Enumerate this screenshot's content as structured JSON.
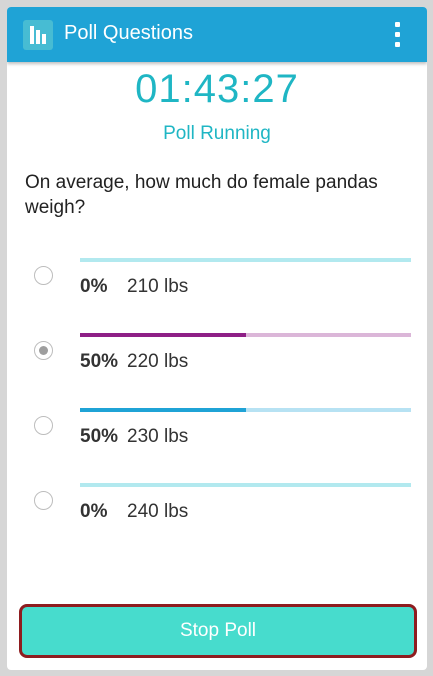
{
  "app_bar": {
    "title": "Poll Questions",
    "app_icon": "bar-chart-icon",
    "menu_icon": "overflow-menu-icon"
  },
  "poll": {
    "timer": "01:43:27",
    "status": "Poll Running",
    "question": "On average, how much do female pandas weigh?",
    "options": [
      {
        "percent_label": "0%",
        "answer": "210 lbs",
        "fraction": 0.0,
        "selected": false,
        "bar_color": "#1fb6c4",
        "track_color": "#b2e9ef"
      },
      {
        "percent_label": "50%",
        "answer": "220 lbs",
        "fraction": 0.5,
        "selected": true,
        "bar_color": "#8e1f86",
        "track_color": "#dbb6d8"
      },
      {
        "percent_label": "50%",
        "answer": "230 lbs",
        "fraction": 0.5,
        "selected": false,
        "bar_color": "#1fa3d6",
        "track_color": "#b7e2f3"
      },
      {
        "percent_label": "0%",
        "answer": "240 lbs",
        "fraction": 0.0,
        "selected": false,
        "bar_color": "#1fb6c4",
        "track_color": "#b2e9ef"
      }
    ]
  },
  "actions": {
    "stop_label": "Stop Poll"
  },
  "colors": {
    "app_bar": "#1fa3d6",
    "accent": "#1fb6c4",
    "button": "#47dccd",
    "button_border": "#8e1c1f"
  }
}
